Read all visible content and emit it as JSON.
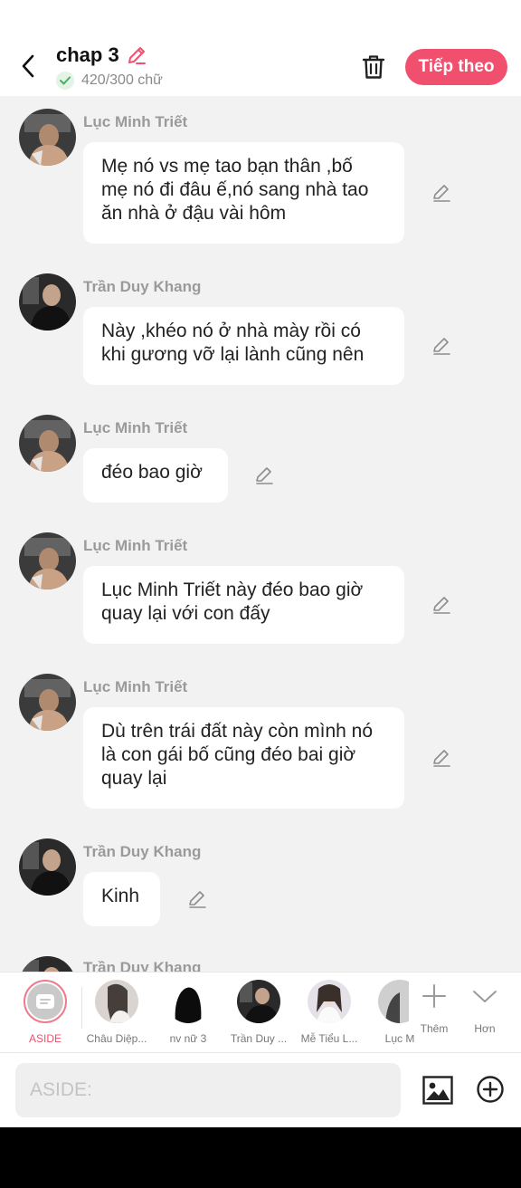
{
  "header": {
    "title": "chap 3",
    "word_count": "420/300 chữ",
    "next_label": "Tiếp theo",
    "accent_color": "#f0506e"
  },
  "messages": [
    {
      "name": "Lục Minh Triết",
      "text": "Mẹ nó vs mẹ tao bạn thân ,bố\nmẹ nó đi đâu ế,nó sang nhà tao\năn nhà ở đậu vài hôm"
    },
    {
      "name": "Trần Duy Khang",
      "text": "Này ,khéo nó ở nhà mày rồi có\nkhi gương vỡ lại lành cũng nên"
    },
    {
      "name": "Lục Minh Triết",
      "text": "đéo bao giờ"
    },
    {
      "name": "Lục Minh Triết",
      "text": "Lục Minh Triết này đéo bao giờ\nquay lại với con đấy"
    },
    {
      "name": "Lục Minh Triết",
      "text": "Dù trên trái đất này còn mình nó\nlà con gái bố cũng đéo bai giờ\nquay lại"
    },
    {
      "name": "Trần Duy Khang",
      "text": "Kinh"
    },
    {
      "name": "Trần Duy Khang",
      "text": ""
    }
  ],
  "characters": [
    {
      "label": "ASIDE"
    },
    {
      "label": "Châu Diệp..."
    },
    {
      "label": "nv nữ 3"
    },
    {
      "label": "Trần Duy ..."
    },
    {
      "label": "Mễ Tiểu L..."
    },
    {
      "label": "Lục M"
    }
  ],
  "tools": {
    "more_label": "Thêm",
    "collapse_label": "Hơn"
  },
  "input": {
    "placeholder": "ASIDE:"
  }
}
